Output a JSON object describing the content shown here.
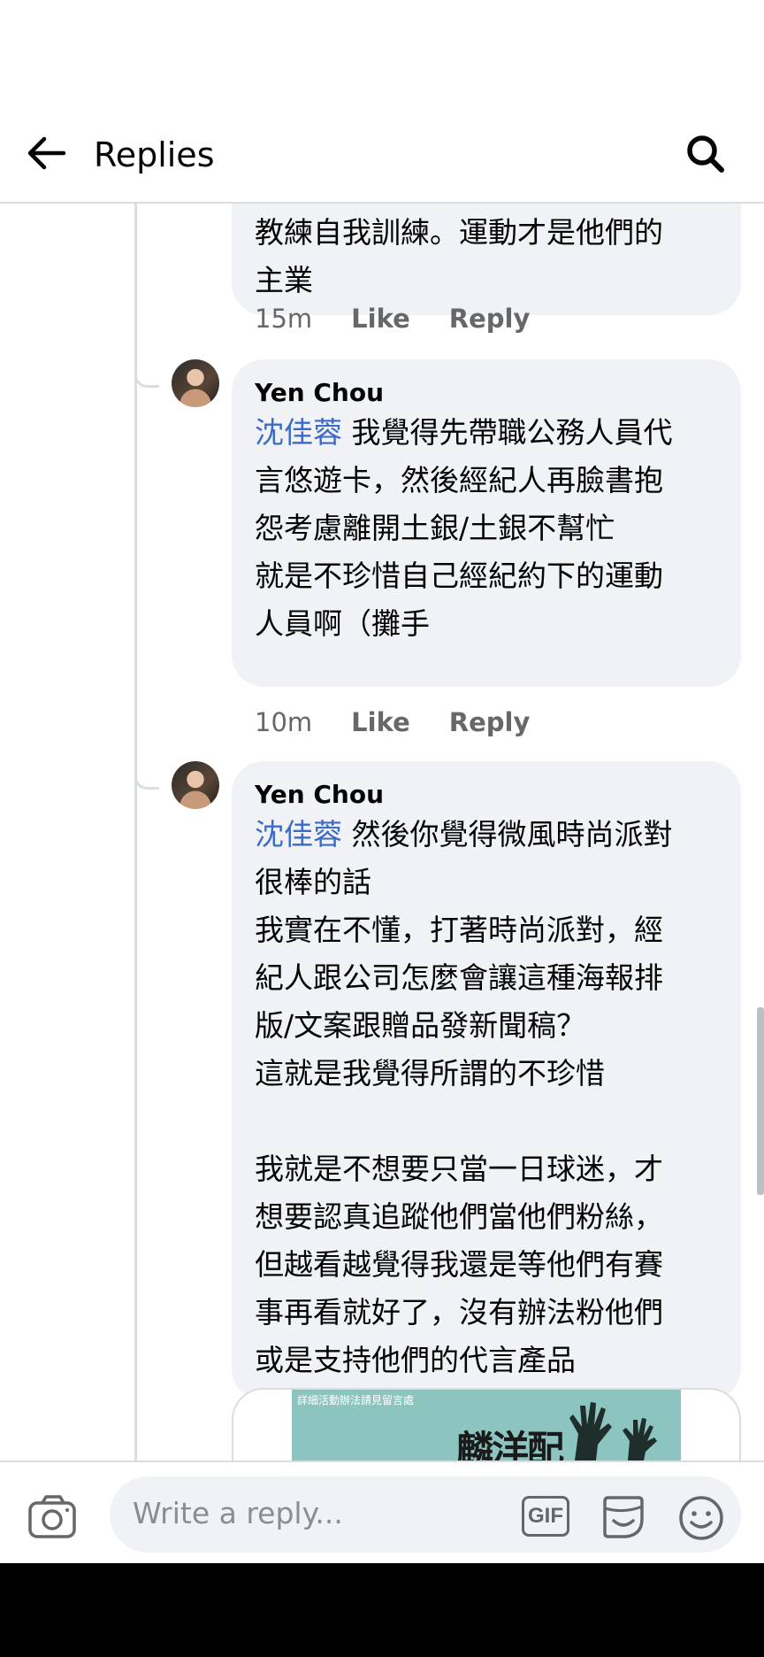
{
  "header": {
    "title": "Replies"
  },
  "replies": [
    {
      "lines": [
        "教練自我訓練。運動才是他們的",
        "主業"
      ],
      "time": "15m",
      "like": "Like",
      "reply": "Reply"
    },
    {
      "author": "Yen Chou",
      "mention": "沈佳蓉",
      "first_line": " 我覺得先帶職公務人員代",
      "lines": [
        "言悠遊卡，然後經紀人再臉書抱",
        "怨考慮離開土銀/土銀不幫忙",
        "就是不珍惜自己經紀約下的運動",
        "人員啊（攤手"
      ],
      "time": "10m",
      "like": "Like",
      "reply": "Reply"
    },
    {
      "author": "Yen Chou",
      "mention": "沈佳蓉",
      "first_line": " 然後你覺得微風時尚派對",
      "lines": [
        "很棒的話",
        "我實在不懂，打著時尚派對，經",
        "紀人跟公司怎麼會讓這種海報排",
        "版/文案跟贈品發新聞稿？",
        "這就是我覺得所謂的不珍惜",
        "",
        "我就是不想要只當一日球迷，才",
        "想要認真追蹤他們當他們粉絲，",
        "但越看越覺得我還是等他們有賽",
        "事再看就好了，沒有辦法粉他們",
        "或是支持他們的代言產品"
      ]
    }
  ],
  "attachment": {
    "poster_caption": "詳細活動辦法請見留言處",
    "poster_headline": "麟洋配"
  },
  "composer": {
    "placeholder": "Write a reply...",
    "gif_label": "GIF"
  },
  "icons": {
    "back": "arrow-left-icon",
    "search": "search-icon",
    "camera": "camera-icon",
    "gif": "gif-icon",
    "sticker": "sticker-icon",
    "emoji": "emoji-icon"
  }
}
